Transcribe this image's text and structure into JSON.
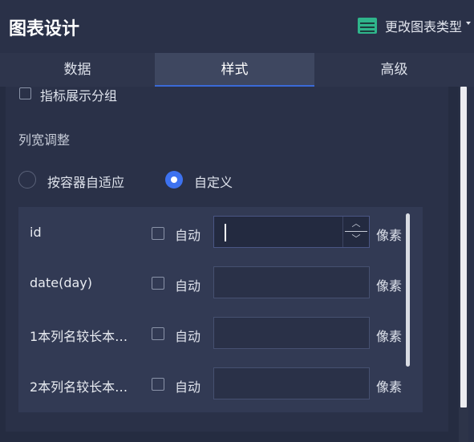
{
  "header": {
    "title": "图表设计",
    "change_type_label": "更改图表类型",
    "change_type_icon": "table-icon"
  },
  "tabs": [
    {
      "label": "数据",
      "active": false
    },
    {
      "label": "样式",
      "active": true
    },
    {
      "label": "高级",
      "active": false
    }
  ],
  "style_panel": {
    "group_checkbox_label": "指标展示分组",
    "column_width_section_title": "列宽调整",
    "radio_options": [
      {
        "label": "按容器自适应",
        "checked": false
      },
      {
        "label": "自定义",
        "checked": true
      }
    ],
    "columns": [
      {
        "name": "id",
        "auto_label": "自动",
        "auto_checked": false,
        "value": "",
        "unit": "像素",
        "focused": true
      },
      {
        "name": "date(day)",
        "auto_label": "自动",
        "auto_checked": false,
        "value": "",
        "unit": "像素",
        "focused": false
      },
      {
        "name": "1本列名较长本…",
        "auto_label": "自动",
        "auto_checked": false,
        "value": "",
        "unit": "像素",
        "focused": false
      },
      {
        "name": "2本列名较长本…",
        "auto_label": "自动",
        "auto_checked": false,
        "value": "",
        "unit": "像素",
        "focused": false
      }
    ],
    "spinner": {
      "up": "^",
      "down": "v"
    }
  },
  "colors": {
    "background": "#2a3148",
    "accent": "#3d72f0",
    "table_icon": "#2fb58b"
  }
}
